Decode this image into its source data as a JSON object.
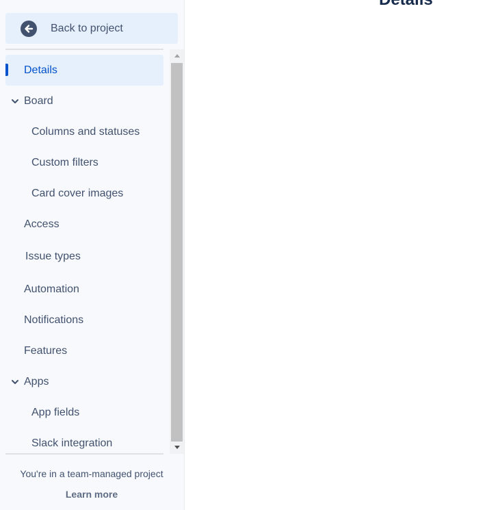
{
  "sidebar": {
    "back_label": "Back to project",
    "items": [
      {
        "label": "Details",
        "selected": true
      },
      {
        "label": "Board",
        "expandable": true
      },
      {
        "label": "Columns and statuses"
      },
      {
        "label": "Custom filters"
      },
      {
        "label": "Card cover images"
      },
      {
        "label": "Access"
      },
      {
        "label": "Issue types"
      },
      {
        "label": "Automation"
      },
      {
        "label": "Notifications"
      },
      {
        "label": "Features"
      },
      {
        "label": "Apps",
        "expandable": true
      },
      {
        "label": "App fields"
      },
      {
        "label": "Slack integration"
      }
    ],
    "footer_text": "You're in a team-managed project",
    "learn_more": "Learn more"
  },
  "main": {
    "title": "Details"
  },
  "colors": {
    "accent": "#0052cc",
    "selected_bg": "#e6effc",
    "text": "#42526e",
    "sidebar_bg": "#f7f9fc"
  },
  "icons": {
    "back": "arrow-left-circle-icon",
    "expand": "chevron-down-icon"
  }
}
